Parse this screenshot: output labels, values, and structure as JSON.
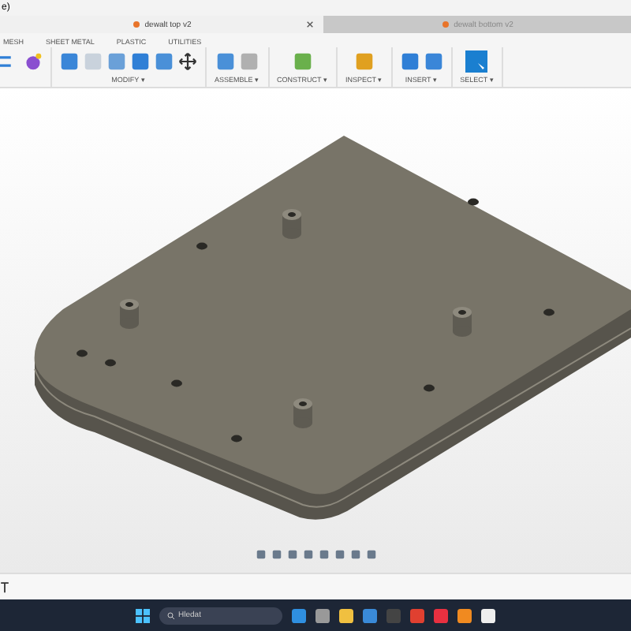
{
  "title_bar": {
    "title": "e)"
  },
  "document_tabs": [
    {
      "label": "dewalt top v2",
      "selected": true,
      "closable": true
    },
    {
      "label": "dewalt bottom v2",
      "selected": false,
      "closable": false
    }
  ],
  "toolbar_tabs": [
    "MESH",
    "SHEET METAL",
    "PLASTIC",
    "UTILITIES"
  ],
  "toolbar_groups": [
    {
      "label": "MODIFY ▾"
    },
    {
      "label": "ASSEMBLE ▾"
    },
    {
      "label": "CONSTRUCT ▾"
    },
    {
      "label": "INSPECT ▾"
    },
    {
      "label": "INSERT ▾"
    },
    {
      "label": "SELECT ▾"
    }
  ],
  "taskbar": {
    "search": {
      "placeholder": "Hledat"
    }
  }
}
